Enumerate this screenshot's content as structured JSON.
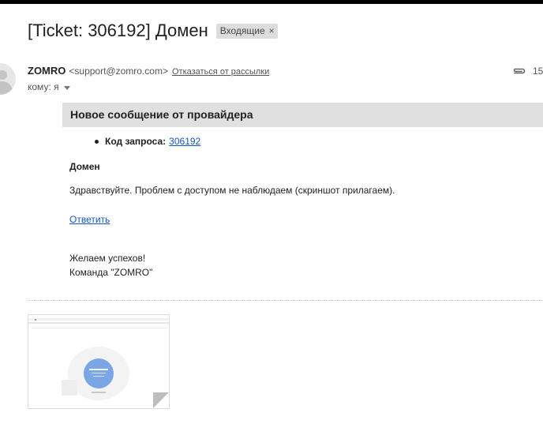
{
  "email": {
    "subject": "[Ticket: 306192] Домен",
    "label": "Входящие",
    "label_remove": "×",
    "sender_name": "ZOMRO",
    "sender_email": "<support@zomro.com>",
    "unsubscribe": "Отказаться от рассылки",
    "to_line": "кому: я",
    "attachment_count": "15"
  },
  "body": {
    "banner": "Новое сообщение от провайдера",
    "request_key": "Код запроса:",
    "request_id": "306192",
    "domain_title": "Домен",
    "message": "Здравствуйте. Проблем с доступом не наблюдаем (скриншот прилагаем).",
    "reply_link": "Ответить",
    "closing": "Желаем успехов!",
    "team": "Команда \"ZOMRO\""
  },
  "icons": {
    "avatar": "person-icon",
    "attachment": "paperclip-icon",
    "dropdown": "caret-down-icon"
  },
  "colors": {
    "link": "#1155cc",
    "banner_bg": "#e0e0e0",
    "label_bg": "#dddddd",
    "thumbnail_circle": "#7aa6e6"
  }
}
